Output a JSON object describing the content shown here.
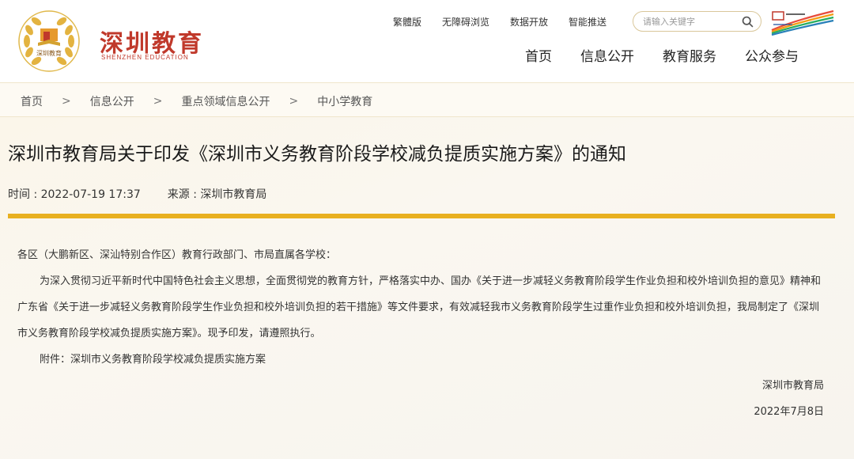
{
  "header": {
    "logo_title": "深圳教育",
    "logo_subtitle": "SHENZHEN EDUCATION",
    "emblem_text": "深圳教育",
    "util_links": [
      "繁體版",
      "无障碍浏览",
      "数据开放",
      "智能推送"
    ],
    "search_placeholder": "请输入关键字",
    "main_nav": [
      "首页",
      "信息公开",
      "教育服务",
      "公众参与"
    ],
    "colors": {
      "brand_red": "#c0392b",
      "accent_gold": "#e8b020"
    }
  },
  "breadcrumb": [
    "首页",
    "信息公开",
    "重点领域信息公开",
    "中小学教育"
  ],
  "breadcrumb_separator": ">",
  "article": {
    "title": "深圳市教育局关于印发《深圳市义务教育阶段学校减负提质实施方案》的通知",
    "time": "时间 : 2022-07-19 17:37",
    "source": "来源 : 深圳市教育局",
    "salutation": "各区（大鹏新区、深汕特别合作区）教育行政部门、市局直属各学校：",
    "paragraph": "为深入贯彻习近平新时代中国特色社会主义思想，全面贯彻党的教育方针，严格落实中办、国办《关于进一步减轻义务教育阶段学生作业负担和校外培训负担的意见》精神和广东省《关于进一步减轻义务教育阶段学生作业负担和校外培训负担的若干措施》等文件要求，有效减轻我市义务教育阶段学生过重作业负担和校外培训负担，我局制定了《深圳市义务教育阶段学校减负提质实施方案》。现予印发，请遵照执行。",
    "attachment": "附件：深圳市义务教育阶段学校减负提质实施方案",
    "signature": "深圳市教育局",
    "date": "2022年7月8日"
  }
}
